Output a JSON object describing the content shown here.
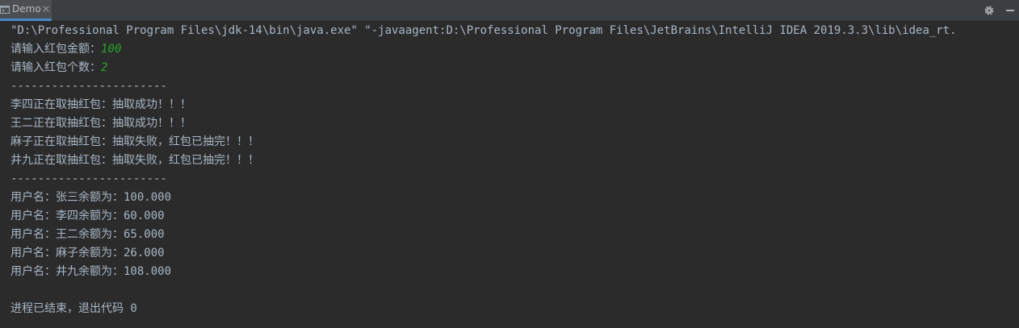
{
  "tab": {
    "title": "Demo",
    "icon": "console-run-icon",
    "close_icon": "close-icon"
  },
  "toolbar": {
    "settings_icon": "gear-icon",
    "hide_icon": "minimize-icon"
  },
  "colors": {
    "background": "#2b2b2b",
    "text": "#a9b7c6",
    "user_input": "#2aa52a",
    "tab_bar": "#3c3f41",
    "tab_active_underline": "#4a88c7"
  },
  "console": {
    "command": "\"D:\\Professional Program Files\\jdk-14\\bin\\java.exe\" \"-javaagent:D:\\Professional Program Files\\JetBrains\\IntelliJ IDEA 2019.3.3\\lib\\idea_rt.",
    "prompt_amount": "请输入红包金额：",
    "input_amount": "100",
    "prompt_count": "请输入红包个数：",
    "input_count": "2",
    "separator": "-----------------------",
    "draws": [
      "李四正在取抽红包：抽取成功！！！",
      "王二正在取抽红包：抽取成功！！！",
      "麻子正在取抽红包：抽取失败，红包已抽完！！！",
      "井九正在取抽红包：抽取失败，红包已抽完！！！"
    ],
    "separator2": "-----------------------",
    "balances": [
      "用户名：张三余额为：100.000",
      "用户名：李四余额为：60.000",
      "用户名：王二余额为：65.000",
      "用户名：麻子余额为：26.000",
      "用户名：井九余额为：108.000"
    ],
    "exit": "进程已结束，退出代码 0"
  }
}
